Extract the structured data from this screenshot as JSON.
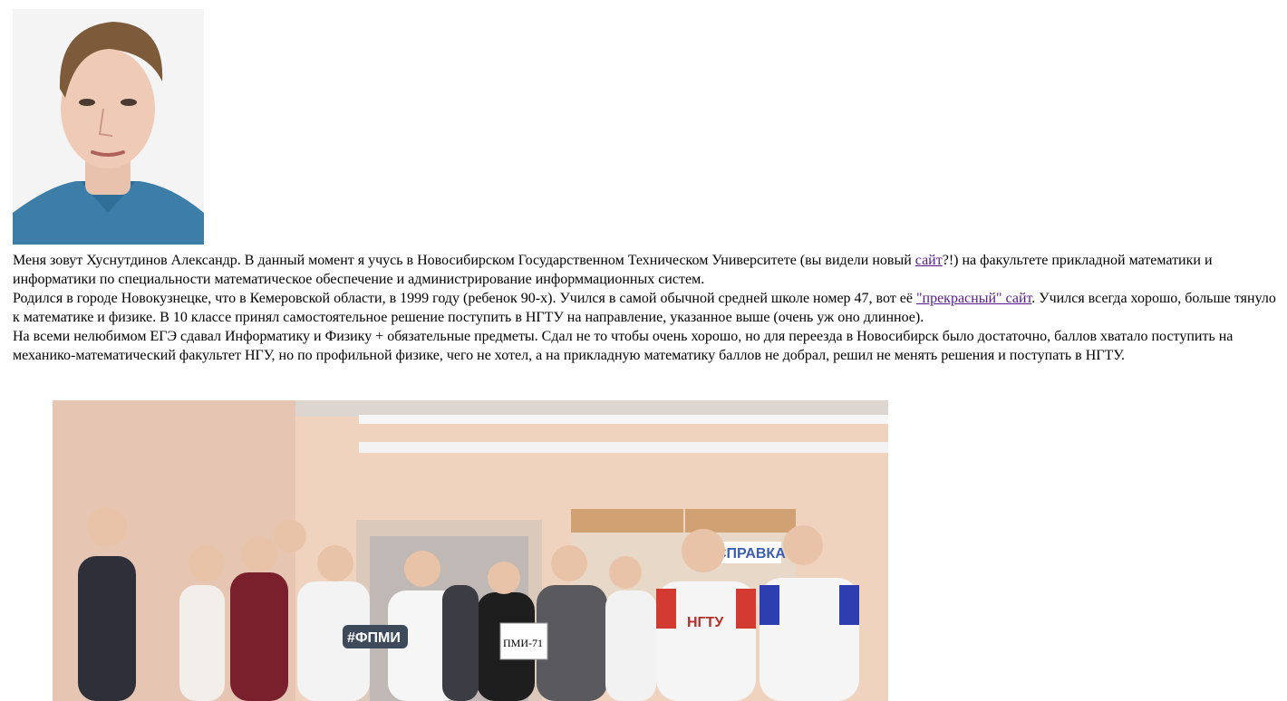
{
  "portrait": {
    "icon": "portrait-photo"
  },
  "bio": {
    "p1_pre": "Меня зовут Хуснутдинов Александр. В данный момент я учусь в Новосибирском Государственном Техническом Университете (вы видели новый ",
    "p1_link": "сайт",
    "p1_post": "?!) на факультете прикладной математики и информатики по специальности математическое обеспечение и администрирование информмационных систем.",
    "p2_pre": "Родился в городе Новокузнецке, что в Кемеровской области, в 1999 году (ребенок 90-х). Учился в самой обычной средней школе номер 47, вот её ",
    "p2_link": "\"прекрасный\" сайт",
    "p2_post": ". Учился всегда хорошо, больше тянуло к математике и физике. В 10 классе принял самостоятельное решение поступить в НГТУ на направление, указанное выше (очень уж оно длинное).",
    "p3": "На всеми нелюбимом ЕГЭ сдавал Информатику и Физику + обязательные предметы. Сдал не то чтобы очень хорошо, но для переезда в Новосибирск было достаточно, баллов хватало поступить на механико-математический факультет НГУ, но по профильной физике, чего не хотел, а на прикладную математику баллов не добрал, решил не менять решения и поступать в НГТУ."
  },
  "group_photo": {
    "icon": "group-photo",
    "sign_hashtag": "#ФПМИ",
    "sign_group": "ПМИ-71",
    "sign_board": "СПРАВКА",
    "shirt_logo": "НГТУ"
  },
  "colors": {
    "link": "#551a8b",
    "wall": "#f0d2bc"
  }
}
